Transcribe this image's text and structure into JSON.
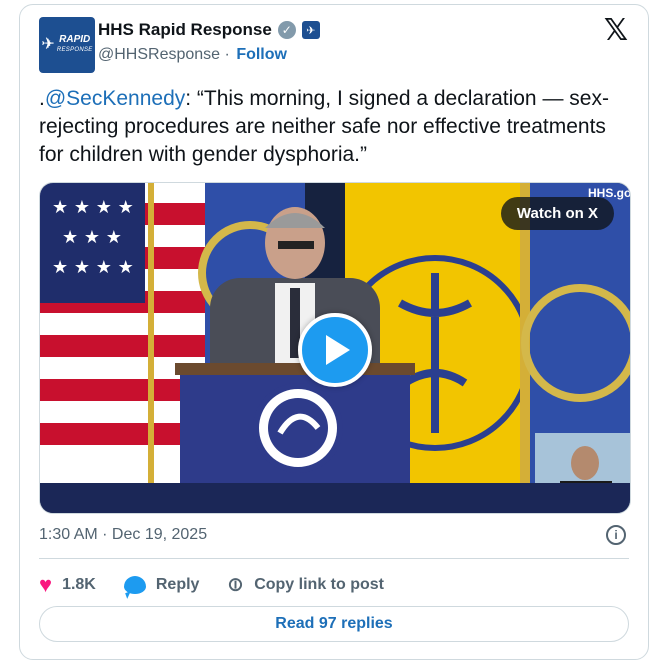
{
  "account": {
    "display_name": "HHS Rapid Response",
    "handle": "@HHSResponse",
    "separator": "·",
    "follow_label": "Follow",
    "avatar_text": "RAPID",
    "avatar_subtext": "RESPONSE"
  },
  "tweet": {
    "prefix": ".",
    "mention": "@SecKennedy",
    "text": ": “This morning, I signed a declaration — sex-rejecting procedures are neither safe nor effective treatments for children with gender dysphoria.”",
    "timestamp": "1:30 AM · Dec 19, 2025"
  },
  "media": {
    "watch_label": "Watch on X",
    "watermark": "HHS.go"
  },
  "actions": {
    "likes_count": "1.8K",
    "reply_label": "Reply",
    "copy_link_label": "Copy link to post"
  },
  "footer": {
    "read_replies_label": "Read 97 replies"
  },
  "icons": {
    "brand_logo": "x-logo-icon",
    "verified": "verified-badge-icon",
    "gov": "government-badge-icon",
    "info": "info-icon",
    "like": "heart-icon",
    "reply": "reply-bubble-icon",
    "link": "link-icon",
    "play": "play-icon"
  },
  "colors": {
    "accent": "#1d9bf0",
    "link": "#1d6fb8",
    "like": "#f91880",
    "muted": "#536471",
    "border": "#cfd9de",
    "avatar_bg": "#1d4f91"
  }
}
